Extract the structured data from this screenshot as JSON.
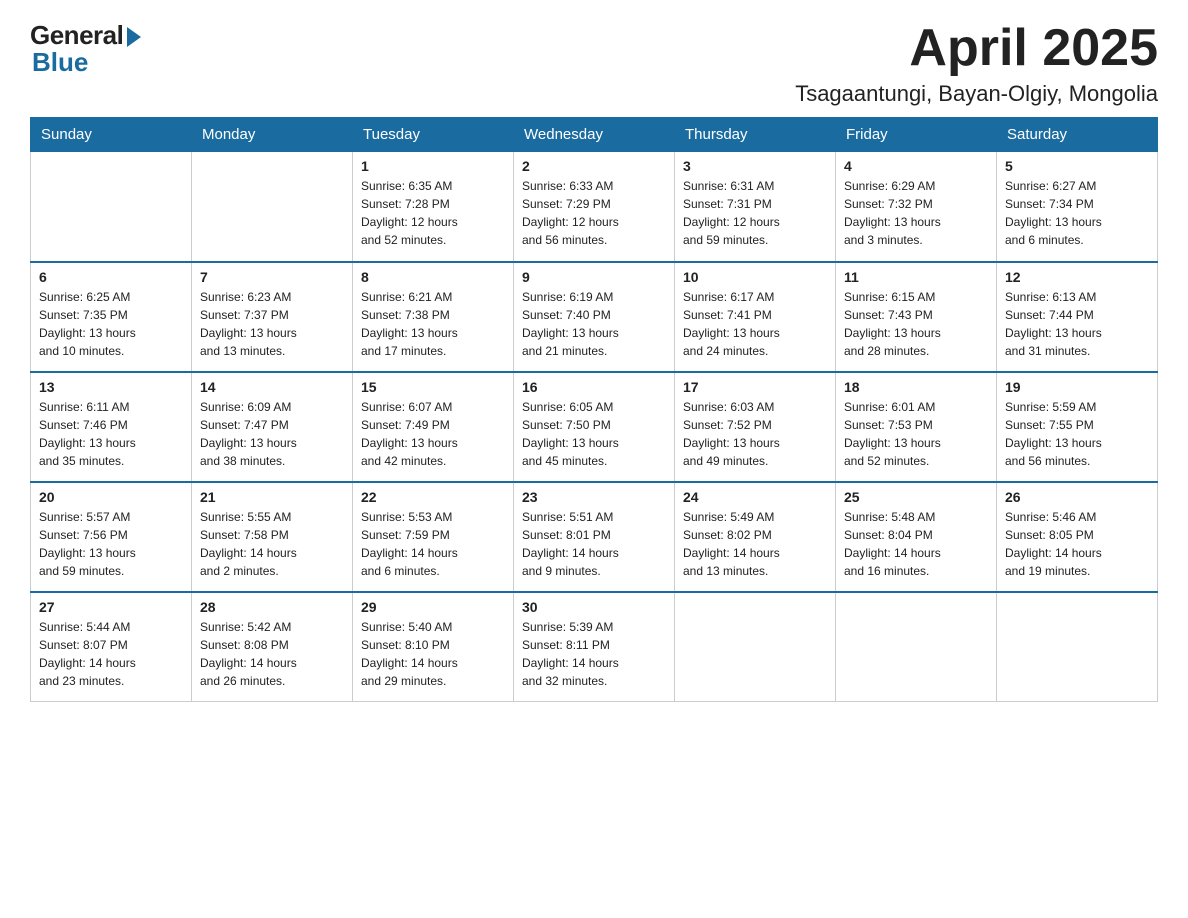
{
  "logo": {
    "general": "General",
    "blue": "Blue",
    "arrow": "▶"
  },
  "title": {
    "month_year": "April 2025",
    "location": "Tsagaantungi, Bayan-Olgiy, Mongolia"
  },
  "weekdays": [
    "Sunday",
    "Monday",
    "Tuesday",
    "Wednesday",
    "Thursday",
    "Friday",
    "Saturday"
  ],
  "weeks": [
    [
      {
        "day": "",
        "info": ""
      },
      {
        "day": "",
        "info": ""
      },
      {
        "day": "1",
        "info": "Sunrise: 6:35 AM\nSunset: 7:28 PM\nDaylight: 12 hours\nand 52 minutes."
      },
      {
        "day": "2",
        "info": "Sunrise: 6:33 AM\nSunset: 7:29 PM\nDaylight: 12 hours\nand 56 minutes."
      },
      {
        "day": "3",
        "info": "Sunrise: 6:31 AM\nSunset: 7:31 PM\nDaylight: 12 hours\nand 59 minutes."
      },
      {
        "day": "4",
        "info": "Sunrise: 6:29 AM\nSunset: 7:32 PM\nDaylight: 13 hours\nand 3 minutes."
      },
      {
        "day": "5",
        "info": "Sunrise: 6:27 AM\nSunset: 7:34 PM\nDaylight: 13 hours\nand 6 minutes."
      }
    ],
    [
      {
        "day": "6",
        "info": "Sunrise: 6:25 AM\nSunset: 7:35 PM\nDaylight: 13 hours\nand 10 minutes."
      },
      {
        "day": "7",
        "info": "Sunrise: 6:23 AM\nSunset: 7:37 PM\nDaylight: 13 hours\nand 13 minutes."
      },
      {
        "day": "8",
        "info": "Sunrise: 6:21 AM\nSunset: 7:38 PM\nDaylight: 13 hours\nand 17 minutes."
      },
      {
        "day": "9",
        "info": "Sunrise: 6:19 AM\nSunset: 7:40 PM\nDaylight: 13 hours\nand 21 minutes."
      },
      {
        "day": "10",
        "info": "Sunrise: 6:17 AM\nSunset: 7:41 PM\nDaylight: 13 hours\nand 24 minutes."
      },
      {
        "day": "11",
        "info": "Sunrise: 6:15 AM\nSunset: 7:43 PM\nDaylight: 13 hours\nand 28 minutes."
      },
      {
        "day": "12",
        "info": "Sunrise: 6:13 AM\nSunset: 7:44 PM\nDaylight: 13 hours\nand 31 minutes."
      }
    ],
    [
      {
        "day": "13",
        "info": "Sunrise: 6:11 AM\nSunset: 7:46 PM\nDaylight: 13 hours\nand 35 minutes."
      },
      {
        "day": "14",
        "info": "Sunrise: 6:09 AM\nSunset: 7:47 PM\nDaylight: 13 hours\nand 38 minutes."
      },
      {
        "day": "15",
        "info": "Sunrise: 6:07 AM\nSunset: 7:49 PM\nDaylight: 13 hours\nand 42 minutes."
      },
      {
        "day": "16",
        "info": "Sunrise: 6:05 AM\nSunset: 7:50 PM\nDaylight: 13 hours\nand 45 minutes."
      },
      {
        "day": "17",
        "info": "Sunrise: 6:03 AM\nSunset: 7:52 PM\nDaylight: 13 hours\nand 49 minutes."
      },
      {
        "day": "18",
        "info": "Sunrise: 6:01 AM\nSunset: 7:53 PM\nDaylight: 13 hours\nand 52 minutes."
      },
      {
        "day": "19",
        "info": "Sunrise: 5:59 AM\nSunset: 7:55 PM\nDaylight: 13 hours\nand 56 minutes."
      }
    ],
    [
      {
        "day": "20",
        "info": "Sunrise: 5:57 AM\nSunset: 7:56 PM\nDaylight: 13 hours\nand 59 minutes."
      },
      {
        "day": "21",
        "info": "Sunrise: 5:55 AM\nSunset: 7:58 PM\nDaylight: 14 hours\nand 2 minutes."
      },
      {
        "day": "22",
        "info": "Sunrise: 5:53 AM\nSunset: 7:59 PM\nDaylight: 14 hours\nand 6 minutes."
      },
      {
        "day": "23",
        "info": "Sunrise: 5:51 AM\nSunset: 8:01 PM\nDaylight: 14 hours\nand 9 minutes."
      },
      {
        "day": "24",
        "info": "Sunrise: 5:49 AM\nSunset: 8:02 PM\nDaylight: 14 hours\nand 13 minutes."
      },
      {
        "day": "25",
        "info": "Sunrise: 5:48 AM\nSunset: 8:04 PM\nDaylight: 14 hours\nand 16 minutes."
      },
      {
        "day": "26",
        "info": "Sunrise: 5:46 AM\nSunset: 8:05 PM\nDaylight: 14 hours\nand 19 minutes."
      }
    ],
    [
      {
        "day": "27",
        "info": "Sunrise: 5:44 AM\nSunset: 8:07 PM\nDaylight: 14 hours\nand 23 minutes."
      },
      {
        "day": "28",
        "info": "Sunrise: 5:42 AM\nSunset: 8:08 PM\nDaylight: 14 hours\nand 26 minutes."
      },
      {
        "day": "29",
        "info": "Sunrise: 5:40 AM\nSunset: 8:10 PM\nDaylight: 14 hours\nand 29 minutes."
      },
      {
        "day": "30",
        "info": "Sunrise: 5:39 AM\nSunset: 8:11 PM\nDaylight: 14 hours\nand 32 minutes."
      },
      {
        "day": "",
        "info": ""
      },
      {
        "day": "",
        "info": ""
      },
      {
        "day": "",
        "info": ""
      }
    ]
  ]
}
